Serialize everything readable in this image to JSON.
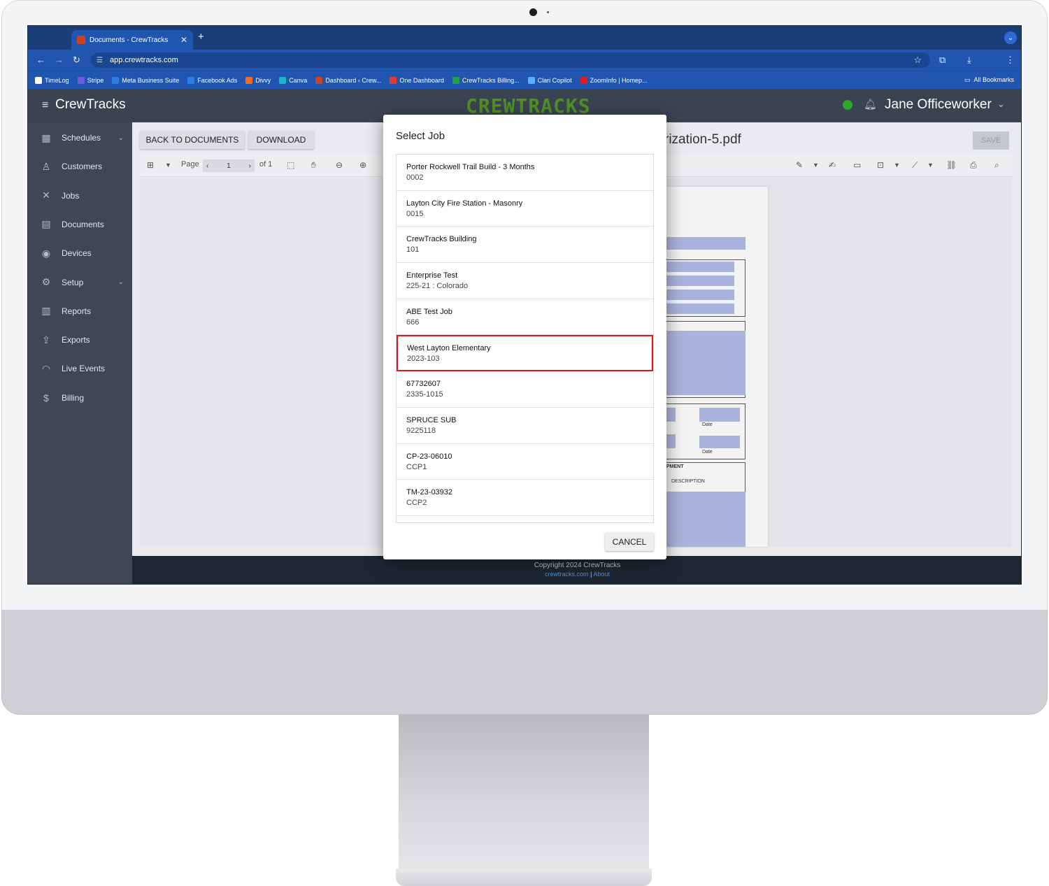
{
  "browser": {
    "tab_title": "Documents - CrewTracks",
    "new_tab": "+",
    "url": "app.crewtracks.com",
    "bookmarks": [
      {
        "label": "TimeLog",
        "color": "#ffffff"
      },
      {
        "label": "Stripe",
        "color": "#6a5be0"
      },
      {
        "label": "Meta Business Suite",
        "color": "#2b7de9"
      },
      {
        "label": "Facebook Ads",
        "color": "#2b7de9"
      },
      {
        "label": "Divvy",
        "color": "#f26b21"
      },
      {
        "label": "Canva",
        "color": "#19b5c9"
      },
      {
        "label": "Dashboard ‹ Crew...",
        "color": "#c9431f"
      },
      {
        "label": "One Dashboard",
        "color": "#e53935"
      },
      {
        "label": "CrewTracks Billing...",
        "color": "#1fa34a"
      },
      {
        "label": "Clari Copilot",
        "color": "#5ab0ff"
      },
      {
        "label": "ZoomInfo | Homep...",
        "color": "#e01b22"
      }
    ],
    "all_bookmarks": "All Bookmarks"
  },
  "header": {
    "brand": "CrewTracks",
    "logo_text": "CREWTRACKS",
    "user_name": "Jane Officeworker",
    "status_color": "#2ea62a"
  },
  "sidebar": {
    "items": [
      {
        "label": "Schedules",
        "icon": "calendar-grid-icon",
        "glyph": "▦",
        "has_chevron": true
      },
      {
        "label": "Customers",
        "icon": "customer-icon",
        "glyph": "♙",
        "has_chevron": false
      },
      {
        "label": "Jobs",
        "icon": "tools-icon",
        "glyph": "✕",
        "has_chevron": false
      },
      {
        "label": "Documents",
        "icon": "documents-icon",
        "glyph": "▤",
        "has_chevron": false
      },
      {
        "label": "Devices",
        "icon": "location-pin-icon",
        "glyph": "◉",
        "has_chevron": false
      },
      {
        "label": "Setup",
        "icon": "gear-icon",
        "glyph": "⚙",
        "has_chevron": true
      },
      {
        "label": "Reports",
        "icon": "bar-chart-icon",
        "glyph": "▥",
        "has_chevron": false
      },
      {
        "label": "Exports",
        "icon": "upload-icon",
        "glyph": "⇪",
        "has_chevron": false
      },
      {
        "label": "Live Events",
        "icon": "broadcast-icon",
        "glyph": "◠",
        "has_chevron": false
      },
      {
        "label": "Billing",
        "icon": "billing-icon",
        "glyph": "$",
        "has_chevron": false
      }
    ]
  },
  "toolbar": {
    "back_label": "BACK TO DOCUMENTS",
    "download_label": "DOWNLOAD",
    "doc_title": "rization-5.pdf",
    "save_label": "SAVE"
  },
  "viewer": {
    "page_label": "Page",
    "page_current": "1",
    "page_total": "of 1",
    "pdf_labels": {
      "date1": "Date",
      "date2": "Date",
      "equipment": "UIPMENT",
      "description": "DESCRIPTION"
    }
  },
  "modal": {
    "title": "Select Job",
    "cancel_label": "CANCEL",
    "jobs": [
      {
        "name": "Porter Rockwell Trail Build - 3 Months",
        "number": "0002"
      },
      {
        "name": "Layton City Fire Station - Masonry",
        "number": "0015"
      },
      {
        "name": "CrewTracks Building",
        "number": "101"
      },
      {
        "name": "Enterprise Test",
        "number": "225-21 : Colorado"
      },
      {
        "name": "ABE Test Job",
        "number": "666"
      },
      {
        "name": "West Layton Elementary",
        "number": "2023-103",
        "highlighted": true
      },
      {
        "name": "67732607",
        "number": "2335-1015"
      },
      {
        "name": "SPRUCE SUB",
        "number": "9225118"
      },
      {
        "name": "CP-23-06010",
        "number": "CCP1"
      },
      {
        "name": "TM-23-03932",
        "number": "CCP2"
      }
    ]
  },
  "footer": {
    "copyright": "Copyright 2024 CrewTracks",
    "link1": "crewtracks.com",
    "separator": "|",
    "link2": "About"
  }
}
